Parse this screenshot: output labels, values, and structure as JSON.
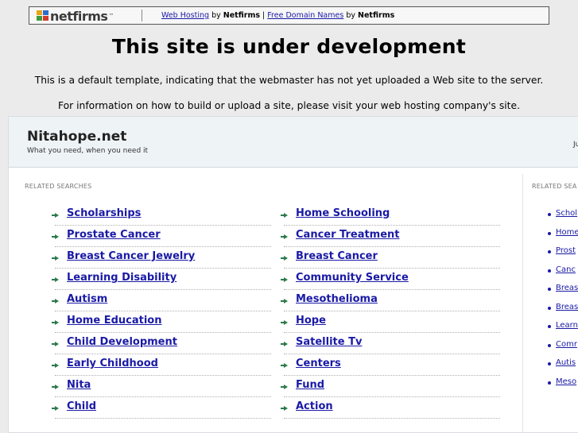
{
  "banner": {
    "logo_text": "netfirms",
    "logo_tm": "™",
    "link1": "Web Hosting",
    "by1": "by",
    "brand1": "Netfirms",
    "pipe": "|",
    "link2": "Free Domain Names",
    "by2": "by",
    "brand2": "Netfirms"
  },
  "headline": "This site is under development",
  "line1": "This is a default template, indicating that the webmaster has not yet uploaded a Web site to the server.",
  "line2": "For information on how to build or upload a site, please visit your web hosting company's site.",
  "panel": {
    "domain": "Nitahope.net",
    "tagline": "What you need, when you need it",
    "head_right": "Ju",
    "related_label": "RELATED SEARCHES",
    "related_label_right": "RELATED SEA",
    "left_links": [
      "Scholarships",
      "Prostate Cancer",
      "Breast Cancer Jewelry",
      "Learning Disability",
      "Autism",
      "Home Education",
      "Child Development",
      "Early Childhood",
      "Nita",
      "Child"
    ],
    "right_links": [
      "Home Schooling",
      "Cancer Treatment",
      "Breast Cancer",
      "Community Service",
      "Mesothelioma",
      "Hope",
      "Satellite Tv",
      "Centers",
      "Fund",
      "Action"
    ],
    "side_links": [
      "Schol",
      "Home",
      "Prost",
      "Canc",
      "Breas",
      "Breas",
      "Learn",
      "Comr",
      "Autis",
      "Meso"
    ]
  },
  "colors": {
    "background": "#ebebeb",
    "link": "#1a1aa6",
    "arrow": "#2c7a4a",
    "panel_header": "#eef3f6"
  }
}
